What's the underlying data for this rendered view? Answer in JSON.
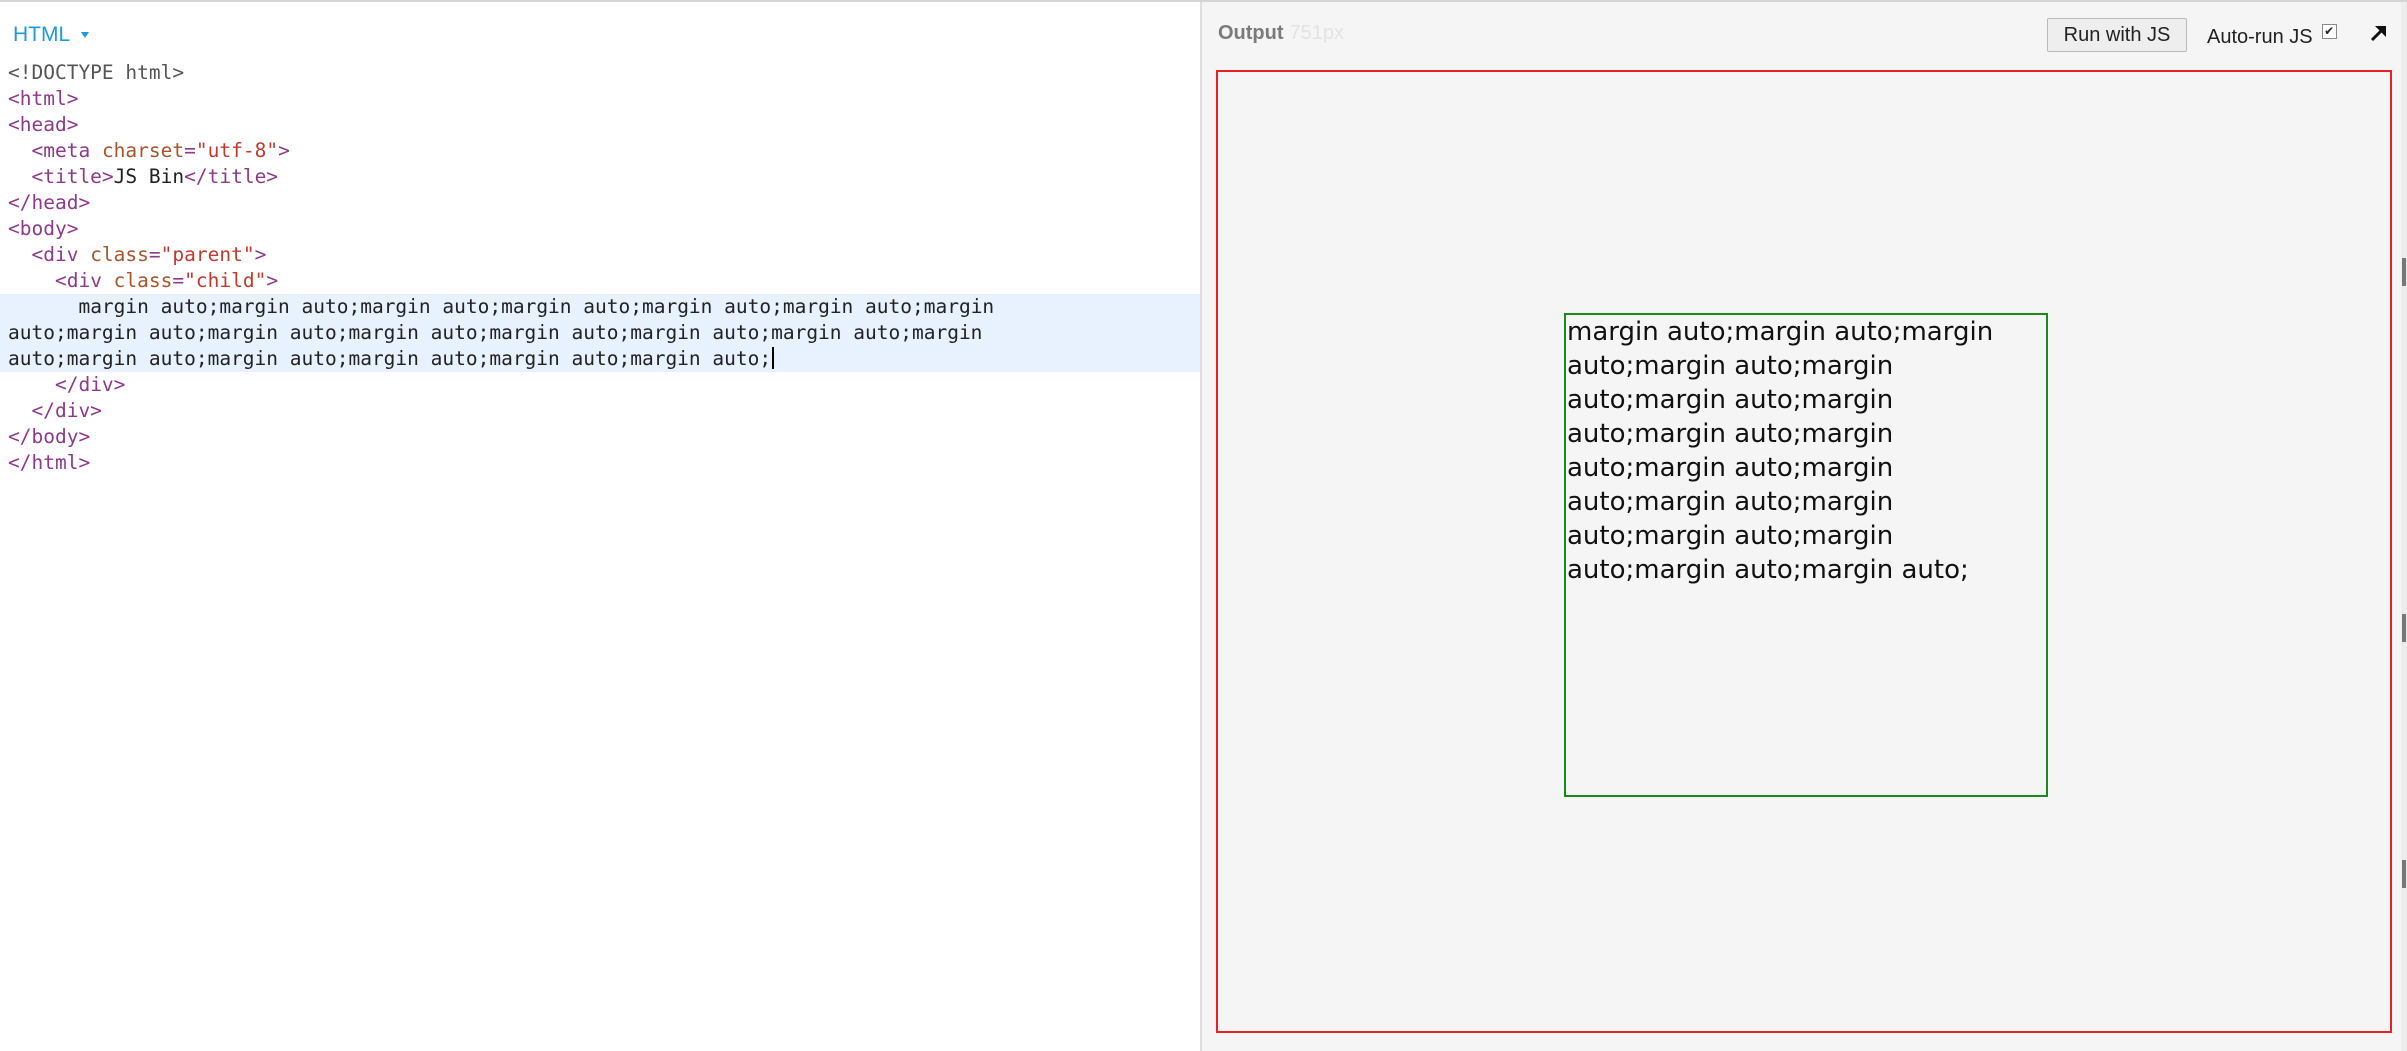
{
  "editor": {
    "title": "HTML",
    "lines": [
      {
        "indent": "",
        "tokens": [
          {
            "t": "doctype",
            "v": "<!DOCTYPE html>"
          }
        ]
      },
      {
        "indent": "",
        "tokens": [
          {
            "t": "tag",
            "v": "<html>"
          }
        ]
      },
      {
        "indent": "",
        "tokens": [
          {
            "t": "tag",
            "v": "<head>"
          }
        ]
      },
      {
        "indent": "  ",
        "tokens": [
          {
            "t": "tag",
            "v": "<meta "
          },
          {
            "t": "attr",
            "v": "charset"
          },
          {
            "t": "tag",
            "v": "="
          },
          {
            "t": "str",
            "v": "\"utf-8\""
          },
          {
            "t": "tag",
            "v": ">"
          }
        ]
      },
      {
        "indent": "  ",
        "tokens": [
          {
            "t": "tag",
            "v": "<title>"
          },
          {
            "t": "text",
            "v": "JS Bin"
          },
          {
            "t": "tag",
            "v": "</title>"
          }
        ]
      },
      {
        "indent": "",
        "tokens": [
          {
            "t": "tag",
            "v": "</head>"
          }
        ]
      },
      {
        "indent": "",
        "tokens": [
          {
            "t": "tag",
            "v": "<body>"
          }
        ]
      },
      {
        "indent": "  ",
        "tokens": [
          {
            "t": "tag",
            "v": "<div "
          },
          {
            "t": "attr",
            "v": "class"
          },
          {
            "t": "tag",
            "v": "="
          },
          {
            "t": "str",
            "v": "\"parent\""
          },
          {
            "t": "tag",
            "v": ">"
          }
        ]
      },
      {
        "indent": "    ",
        "tokens": [
          {
            "t": "tag",
            "v": "<div "
          },
          {
            "t": "attr",
            "v": "class"
          },
          {
            "t": "tag",
            "v": "="
          },
          {
            "t": "str",
            "v": "\"child\""
          },
          {
            "t": "tag",
            "v": ">"
          }
        ]
      },
      {
        "indent": "      ",
        "active": true,
        "tokens": [
          {
            "t": "text",
            "v": "margin auto;margin auto;margin auto;margin auto;margin auto;margin auto;margin"
          }
        ]
      },
      {
        "indent": "",
        "active": true,
        "tokens": [
          {
            "t": "text",
            "v": "auto;margin auto;margin auto;margin auto;margin auto;margin auto;margin auto;margin"
          }
        ]
      },
      {
        "indent": "",
        "active": true,
        "cursor": true,
        "tokens": [
          {
            "t": "text",
            "v": "auto;margin auto;margin auto;margin auto;margin auto;margin auto;"
          }
        ]
      },
      {
        "indent": "    ",
        "tokens": [
          {
            "t": "tag",
            "v": "</div>"
          }
        ]
      },
      {
        "indent": "  ",
        "tokens": [
          {
            "t": "tag",
            "v": "</div>"
          }
        ]
      },
      {
        "indent": "",
        "tokens": [
          {
            "t": "tag",
            "v": "</body>"
          }
        ]
      },
      {
        "indent": "",
        "tokens": [
          {
            "t": "tag",
            "v": "</html>"
          }
        ]
      }
    ]
  },
  "output": {
    "title": "Output",
    "width_label": "751px",
    "run_button": "Run with JS",
    "autorun_label": "Auto-run JS",
    "autorun_checked": true,
    "popout_icon": "popout-arrow-icon",
    "child_text": "margin auto;margin auto;margin auto;margin auto;margin auto;margin auto;margin auto;margin auto;margin auto;margin auto;margin auto;margin auto;margin auto;margin auto;margin auto;margin auto;margin auto;",
    "colors": {
      "parent_border": "#e82222",
      "child_border": "#1b8a1b",
      "background": "#f5f5f5"
    }
  }
}
